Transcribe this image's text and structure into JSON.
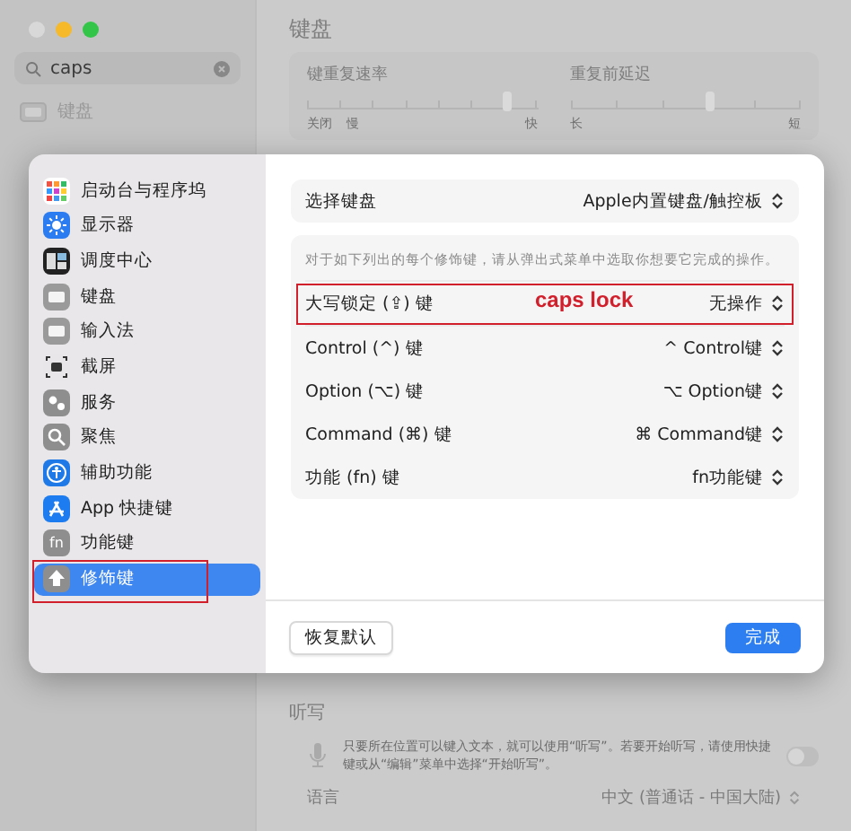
{
  "background": {
    "search": {
      "value": "caps"
    },
    "sidebar_items": [
      {
        "label": "键盘"
      }
    ],
    "title": "键盘",
    "sliders": [
      {
        "label": "键重复速率",
        "level": 0.86,
        "min_labels": [
          "关闭",
          "慢"
        ],
        "max_label": "快"
      },
      {
        "label": "重复前延迟",
        "level": 0.6,
        "min_labels": [
          "长"
        ],
        "max_label": "短"
      }
    ],
    "dictation": {
      "title": "听写",
      "text": "只要所在位置可以键入文本，就可以使用“听写”。若要开始听写，请使用快捷键或从“编辑”菜单中选择“开始听写”。",
      "on": false
    },
    "language": {
      "label": "语言",
      "value": "中文 (普通话 - 中国大陆)"
    }
  },
  "sheet": {
    "sidebar": [
      {
        "label": "启动台与程序坞",
        "kind": "grid",
        "selected": false
      },
      {
        "label": "显示器",
        "kind": "sun",
        "selected": false
      },
      {
        "label": "调度中心",
        "kind": "windows",
        "selected": false
      },
      {
        "label": "键盘",
        "kind": "keyboard",
        "selected": false
      },
      {
        "label": "输入法",
        "kind": "keyboard",
        "selected": false
      },
      {
        "label": "截屏",
        "kind": "camera",
        "selected": false
      },
      {
        "label": "服务",
        "kind": "gears",
        "selected": false
      },
      {
        "label": "聚焦",
        "kind": "search",
        "selected": false
      },
      {
        "label": "辅助功能",
        "kind": "accessibility",
        "selected": false
      },
      {
        "label": "App 快捷键",
        "kind": "appstore",
        "selected": false
      },
      {
        "label": "功能键",
        "kind": "fn",
        "icon_text": "fn",
        "selected": false
      },
      {
        "label": "修饰键",
        "kind": "shift",
        "selected": true,
        "highlighted": true
      }
    ],
    "keyboard_select": {
      "label": "选择键盘",
      "value": "Apple内置键盘/触控板"
    },
    "description": "对于如下列出的每个修饰键，请从弹出式菜单中选取你想要它完成的操作。",
    "rows": [
      {
        "label": "大写锁定 (⇪) 键",
        "value": "无操作",
        "highlighted": true,
        "annotation": "caps lock"
      },
      {
        "label": "Control (^) 键",
        "value": "^ Control键",
        "highlighted": false
      },
      {
        "label": "Option (⌥) 键",
        "value": "⌥ Option键",
        "highlighted": false
      },
      {
        "label": "Command (⌘) 键",
        "value": "⌘ Command键",
        "highlighted": false
      },
      {
        "label": "功能 (fn) 键",
        "value": "fn功能键",
        "highlighted": false
      }
    ],
    "buttons": [
      {
        "label": "恢复默认",
        "kind": "secondary"
      },
      {
        "label": "完成",
        "kind": "primary"
      }
    ]
  }
}
